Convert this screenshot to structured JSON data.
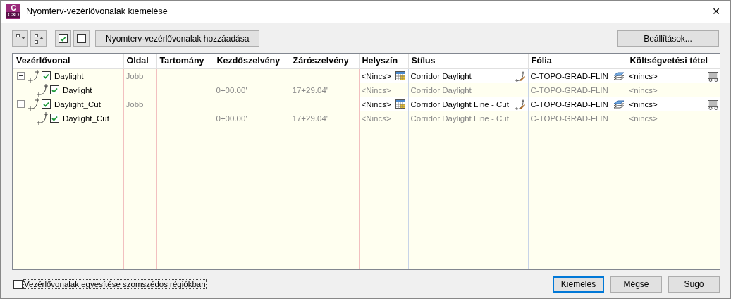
{
  "window": {
    "title": "Nyomterv-vezérlővonalak kiemelése",
    "logo": {
      "letter": "C",
      "caption": "C3D"
    },
    "close": "✕"
  },
  "toolbar": {
    "check_all": {
      "checked": true
    },
    "uncheck_all": {
      "checked": false
    },
    "add_button": "Nyomterv-vezérlővonalak hozzáadása",
    "settings_button": "Beállítások..."
  },
  "table": {
    "columns": [
      "Vezérlővonal",
      "Oldal",
      "Tartomány",
      "Kezdőszelvény",
      "Zárószelvény",
      "Helyszín",
      "Stílus",
      "Fólia",
      "Költségvetési tétel"
    ],
    "rows": [
      {
        "name": "Daylight",
        "checked": true,
        "expanded": true,
        "side": "Jobb",
        "location": "<Nincs>",
        "style": "Corridor Daylight",
        "layer": "C-TOPO-GRAD-FLIN",
        "pay_item": "<nincs>",
        "children": [
          {
            "name": "Daylight",
            "checked": true,
            "start": "0+00.00'",
            "end": "17+29.04'",
            "location": "<Nincs>",
            "style": "Corridor Daylight",
            "layer": "C-TOPO-GRAD-FLIN",
            "pay_item": "<nincs>"
          }
        ]
      },
      {
        "name": "Daylight_Cut",
        "checked": true,
        "expanded": true,
        "side": "Jobb",
        "location": "<Nincs>",
        "style": "Corridor Daylight Line - Cut",
        "layer": "C-TOPO-GRAD-FLIN",
        "pay_item": "<nincs>",
        "children": [
          {
            "name": "Daylight_Cut",
            "checked": true,
            "start": "0+00.00'",
            "end": "17+29.04'",
            "location": "<Nincs>",
            "style": "Corridor Daylight Line - Cut",
            "layer": "C-TOPO-GRAD-FLIN",
            "pay_item": "<nincs>"
          }
        ]
      }
    ]
  },
  "footer": {
    "merge_option": {
      "label": "Vezérlővonalak egyesítése szomszédos régiókban",
      "checked": false
    },
    "buttons": [
      {
        "label": "Kiemelés",
        "default": true
      },
      {
        "label": "Mégse",
        "default": false
      },
      {
        "label": "Súgó",
        "default": false
      }
    ]
  }
}
